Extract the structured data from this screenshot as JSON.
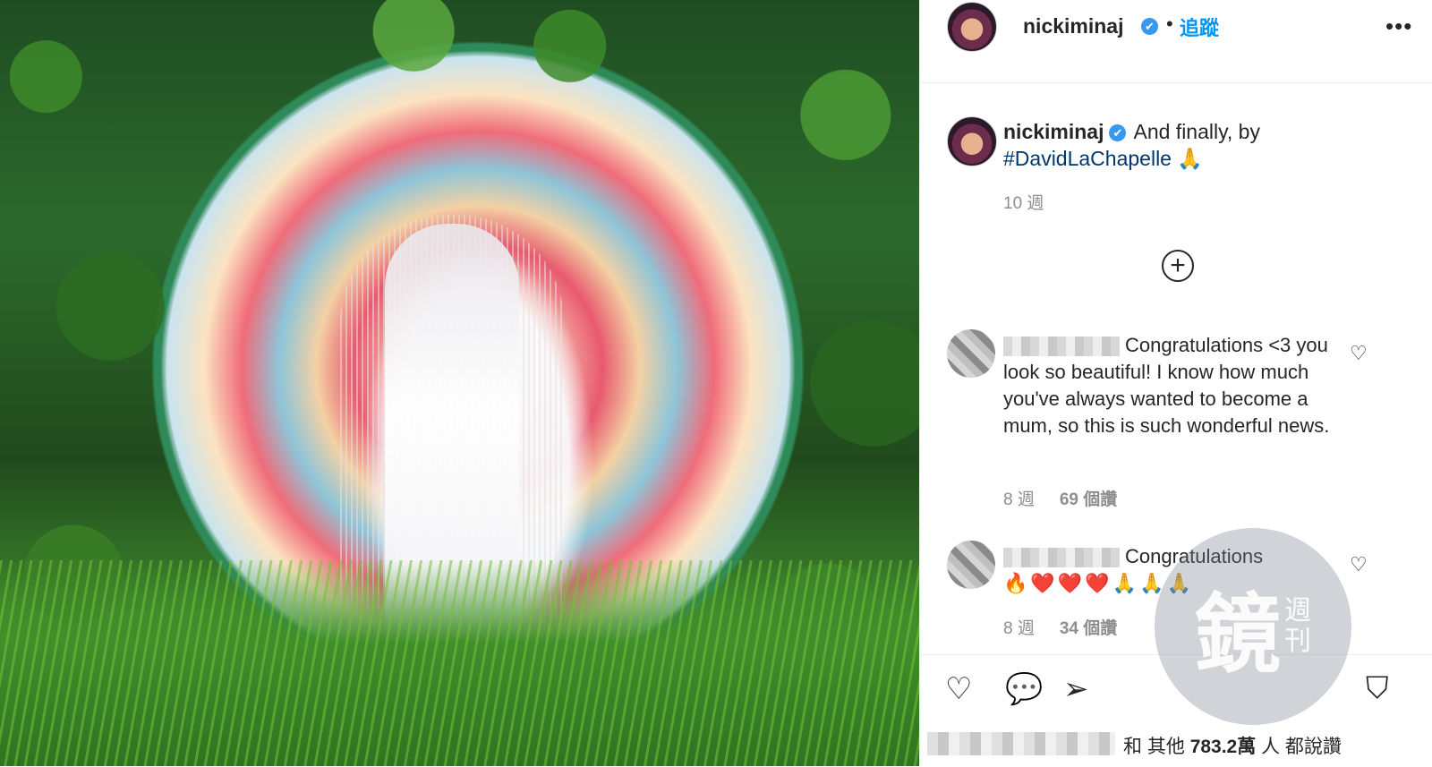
{
  "header": {
    "username": "nickiminaj",
    "verified_mark": "✔",
    "separator": "•",
    "follow_label": "追蹤",
    "more_label": "•••"
  },
  "caption": {
    "username": "nickiminaj",
    "verified_mark": "✔",
    "text": "And finally, by",
    "hashtag": "#DavidLaChapelle",
    "emoji": "🙏",
    "age": "10 週"
  },
  "load_more_label": "+",
  "comments": [
    {
      "text": "Congratulations <3 you look so beautiful! I know how much you've always wanted to become a mum, so this is such wonderful news.",
      "age": "8 週",
      "likes": "69 個讚",
      "heart_icon": "♡"
    },
    {
      "text": "Congratulations",
      "emojis": [
        "🔥",
        "❤️",
        "❤️",
        "❤️",
        "🙏",
        "🙏",
        "🙏"
      ],
      "age": "8 週",
      "likes": "34 個讚",
      "heart_icon": "♡"
    }
  ],
  "actions": {
    "like_icon": "♡",
    "comment_icon": "💬",
    "share_icon": "➢",
    "save_icon": "⛉"
  },
  "likes_summary": {
    "prefix": "和 其他",
    "count": "783.2萬",
    "suffix": "人 都說讚"
  },
  "watermark": {
    "main": "鏡",
    "small": [
      "週",
      "刊"
    ]
  }
}
